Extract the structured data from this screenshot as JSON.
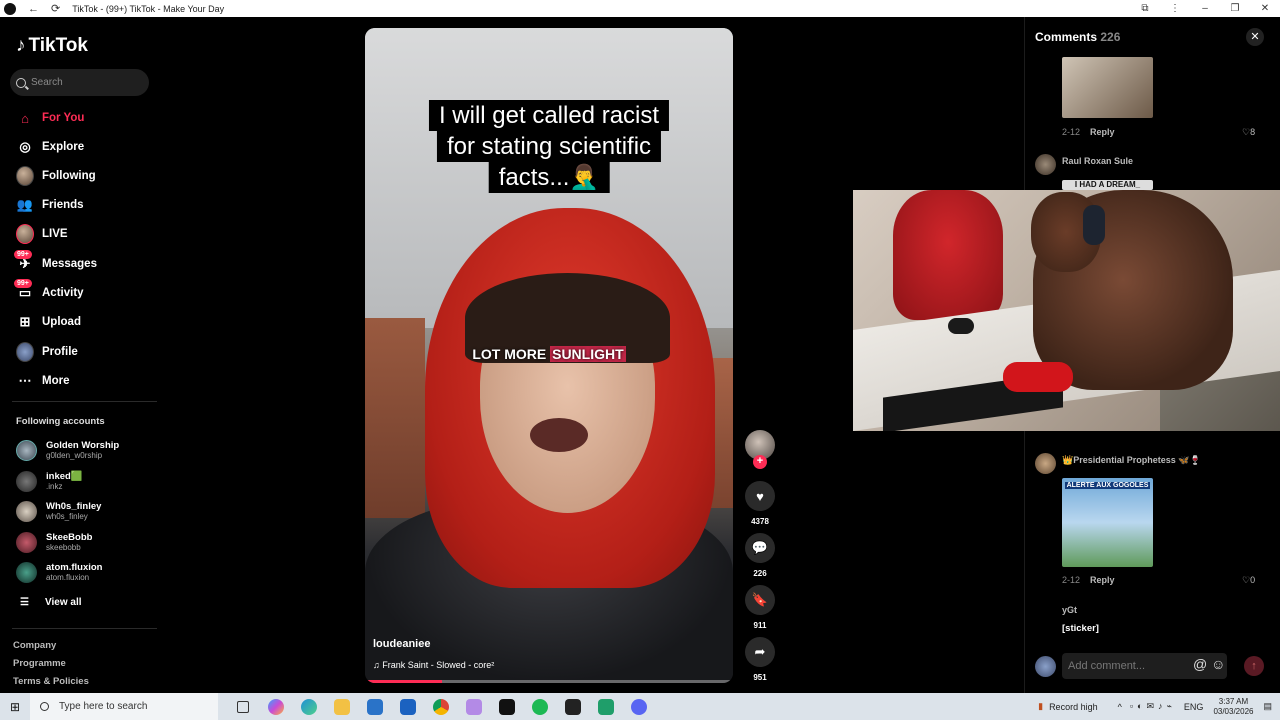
{
  "browser": {
    "title": "TikTok - (99+) TikTok - Make Your Day"
  },
  "sidebar": {
    "logo": "TikTok",
    "search_placeholder": "Search",
    "nav": [
      {
        "label": "For You",
        "icon": "home-icon",
        "active": true
      },
      {
        "label": "Explore",
        "icon": "compass-icon"
      },
      {
        "label": "Following",
        "icon": "following-avatar-icon"
      },
      {
        "label": "Friends",
        "icon": "friends-icon"
      },
      {
        "label": "LIVE",
        "icon": "live-icon"
      },
      {
        "label": "Messages",
        "icon": "messages-icon",
        "badge": "99+"
      },
      {
        "label": "Activity",
        "icon": "activity-icon",
        "badge": "99+"
      },
      {
        "label": "Upload",
        "icon": "upload-icon"
      },
      {
        "label": "Profile",
        "icon": "profile-avatar-icon"
      },
      {
        "label": "More",
        "icon": "more-icon"
      }
    ],
    "following_title": "Following accounts",
    "accounts": [
      {
        "name": "Golden Worship",
        "handle": "g0lden_w0rship"
      },
      {
        "name": "inked🟩",
        "handle": ".inkz"
      },
      {
        "name": "Wh0s_finley",
        "handle": "wh0s_finley"
      },
      {
        "name": "SkeeBobb",
        "handle": "skeebobb"
      },
      {
        "name": "atom.fluxion",
        "handle": "atom.fluxion"
      }
    ],
    "view_all": "View all",
    "footer": [
      "Company",
      "Programme",
      "Terms & Policies"
    ]
  },
  "video": {
    "caption_lines": [
      "I will get called racist",
      "for stating scientific",
      "facts...🤦‍♂️"
    ],
    "subtitle_plain": "LOT MORE ",
    "subtitle_highlight": "SUNLIGHT",
    "author": "loudeaniee",
    "music": "Frank Saint - Slowed - core²",
    "progress": 0.21
  },
  "actions": {
    "likes": "4378",
    "comments": "226",
    "saves": "911",
    "shares": "951"
  },
  "comments": {
    "title": "Comments",
    "count": "226",
    "items": [
      {
        "date": "2-12",
        "reply": "Reply",
        "likes": "8"
      },
      {
        "user": "Raul Roxan Sule",
        "image_text": "I HAD A DREAM_"
      },
      {
        "user": "👑Presidential Prophetess 🦋🍷",
        "image_text": "ALERTE AUX GOGOLES",
        "date": "2-12",
        "reply": "Reply",
        "likes": "0"
      },
      {
        "user": "yGt",
        "text": "[sticker]"
      }
    ],
    "input_placeholder": "Add comment..."
  },
  "taskbar": {
    "search_placeholder": "Type here to search",
    "weather": "Record high",
    "lang": "ENG",
    "time": "3:37 AM",
    "date": "03/03/2026"
  }
}
